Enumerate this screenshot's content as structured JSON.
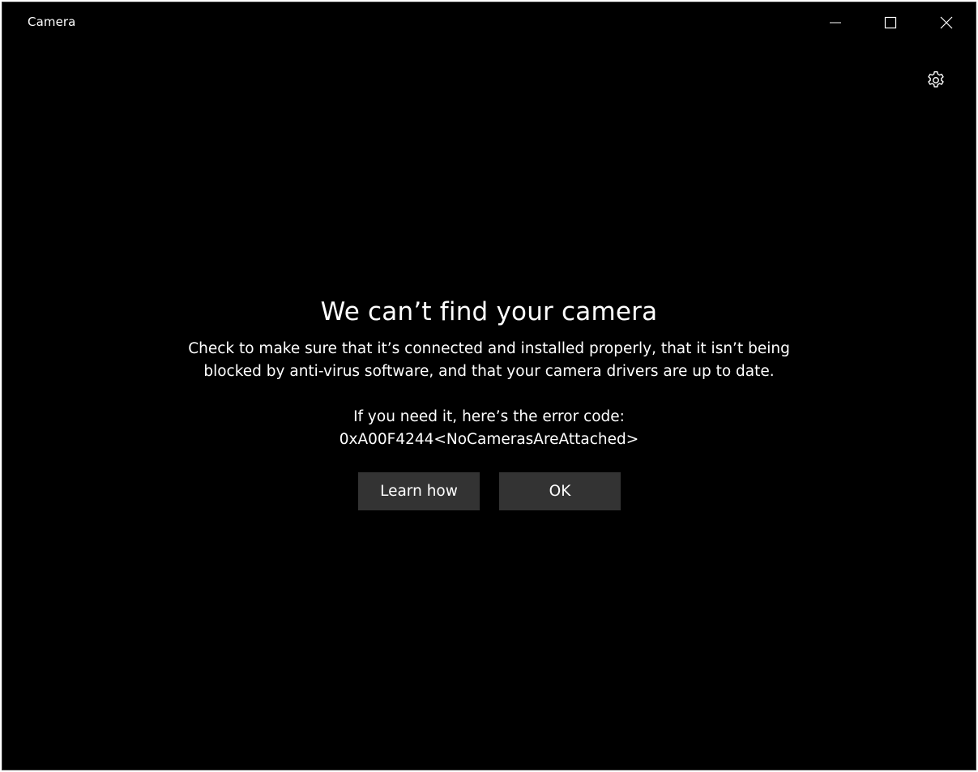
{
  "window": {
    "title": "Camera",
    "minimize_icon": "minimize-icon",
    "maximize_icon": "maximize-icon",
    "close_icon": "close-icon"
  },
  "toolbar": {
    "settings_icon": "gear-icon"
  },
  "error": {
    "heading": "We can’t find your camera",
    "message_line1": "Check to make sure that it’s connected and installed properly, that it isn’t being",
    "message_line2": "blocked by anti-virus software, and that your camera drivers are up to date.",
    "code_label": "If you need it, here’s the error code:",
    "code": "0xA00F4244<NoCamerasAreAttached>"
  },
  "actions": {
    "learn_how_label": "Learn how",
    "ok_label": "OK"
  },
  "colors": {
    "background": "#000000",
    "text": "#ffffff",
    "button_bg": "#333333"
  }
}
